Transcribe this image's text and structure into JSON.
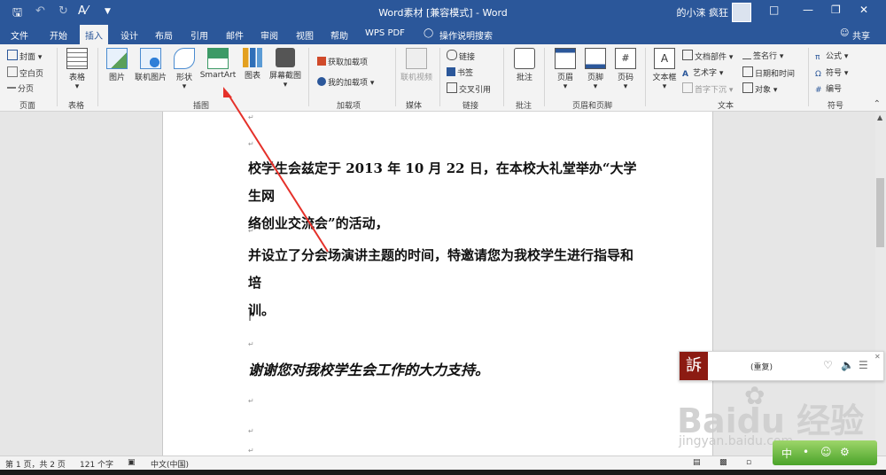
{
  "window": {
    "title": "Word素材 [兼容模式] - Word",
    "user": "的小涞 疯狂",
    "title_colors": {
      "bar": "#2b579a"
    }
  },
  "quick_access": {
    "save_icon": "save-icon",
    "undo_icon": "undo-icon",
    "redo_icon": "redo-icon",
    "format_icon": "format-painter-icon"
  },
  "tabs": [
    "文件",
    "开始",
    "插入",
    "设计",
    "布局",
    "引用",
    "邮件",
    "审阅",
    "视图",
    "帮助",
    "WPS PDF",
    "操作说明搜索"
  ],
  "active_tab": "插入",
  "share_label": "共享",
  "ribbon": {
    "pages": {
      "cover": "封面",
      "blank": "空白页",
      "break": "分页",
      "label": "页面"
    },
    "table": {
      "table": "表格",
      "label": "表格"
    },
    "illustrations": {
      "picture": "图片",
      "online_picture": "联机图片",
      "shapes": "形状",
      "smartart": "SmartArt",
      "chart": "图表",
      "screenshot": "屏幕截图",
      "label": "插图"
    },
    "addins": {
      "get": "获取加载项",
      "my": "我的加载项",
      "label": "加载项"
    },
    "media": {
      "online_video": "联机视频",
      "label": "媒体"
    },
    "links": {
      "link": "链接",
      "bookmark": "书签",
      "cross_ref": "交叉引用",
      "label": "链接"
    },
    "comments": {
      "comment": "批注",
      "label": "批注"
    },
    "header_footer": {
      "header": "页眉",
      "footer": "页脚",
      "page_number": "页码",
      "label": "页眉和页脚"
    },
    "text": {
      "textbox": "文本框",
      "quick_parts": "文档部件",
      "wordart": "艺术字",
      "dropcap": "首字下沉",
      "signature": "签名行",
      "datetime": "日期和时间",
      "object": "对象",
      "label": "文本"
    },
    "symbols": {
      "equation": "公式",
      "symbol": "符号",
      "number": "编号",
      "label": "符号"
    }
  },
  "document": {
    "para1_line1": "校学生会兹定于 2013 年 10 月 22 日，在本校大礼堂举办“大学生网",
    "para1_line2": "络创业交流会”的活动，",
    "para2_line1": "并设立了分会场演讲主题的时间，特邀请您为我校学生进行指导和培",
    "para2_line2": "训。",
    "para3": "谢谢您对我校学生会工作的大力支持。",
    "para_mark": "↵"
  },
  "status": {
    "page": "第 1 页，共 2 页",
    "words": "121 个字",
    "lang": "中文(中国)"
  },
  "player": {
    "logo": "訴",
    "text": "(重复)"
  },
  "watermark": {
    "brand": "Baidu 经验",
    "url": "jingyan.baidu.com"
  },
  "ime": {
    "label": "中"
  }
}
